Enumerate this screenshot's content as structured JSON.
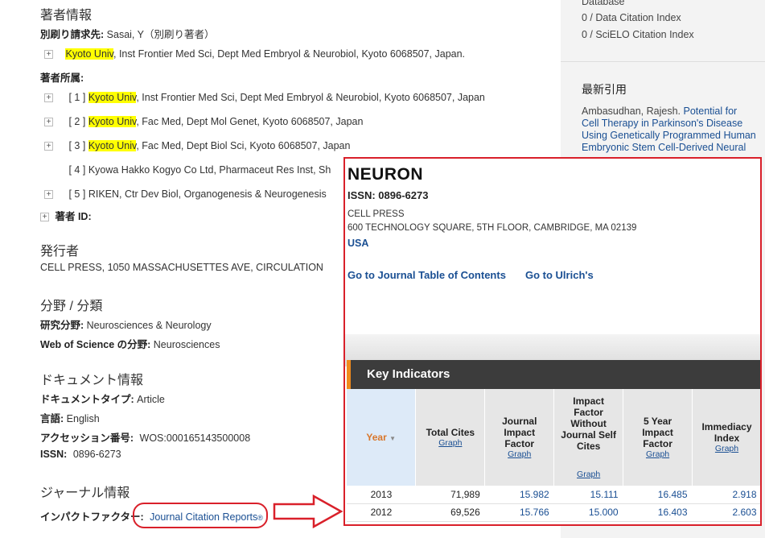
{
  "author": {
    "section_title": "著者情報",
    "reprint_label": "別刷り請求先:",
    "reprint_value": "Sasai, Y（別刷り著者）",
    "reprint_org": "Kyoto Univ",
    "reprint_addr": ", Inst Frontier Med Sci, Dept Med Embryol & Neurobiol, Kyoto 6068507, Japan.",
    "affil_label": "著者所属:",
    "affiliations": [
      {
        "num": "[ 1 ]",
        "org": "Kyoto Univ",
        "rest": ", Inst Frontier Med Sci, Dept Med Embryol & Neurobiol, Kyoto 6068507, Japan"
      },
      {
        "num": "[ 2 ]",
        "org": "Kyoto Univ",
        "rest": ", Fac Med, Dept Mol Genet, Kyoto 6068507, Japan"
      },
      {
        "num": "[ 3 ]",
        "org": "Kyoto Univ",
        "rest": ", Fac Med, Dept Biol Sci, Kyoto 6068507, Japan"
      },
      {
        "num": "[ 4 ]",
        "org": "",
        "rest": "Kyowa Hakko Kogyo Co Ltd, Pharmaceut Res Inst, Sh"
      },
      {
        "num": "[ 5 ]",
        "org": "",
        "rest": "RIKEN, Ctr Dev Biol, Organogenesis & Neurogenesis"
      }
    ],
    "author_id_label": "著者 ID:"
  },
  "publisher": {
    "section_title": "発行者",
    "value": "CELL PRESS, 1050 MASSACHUSETTES AVE, CIRCULATION"
  },
  "category": {
    "section_title": "分野 / 分類",
    "research_label": "研究分野:",
    "research_value": "Neurosciences & Neurology",
    "wos_label": "Web of Science の分野:",
    "wos_value": "Neurosciences"
  },
  "document": {
    "section_title": "ドキュメント情報",
    "type_label": "ドキュメントタイプ:",
    "type_value": "Article",
    "lang_label": "言語:",
    "lang_value": "English",
    "accession_label": "アクセッション番号:",
    "accession_value": "WOS:000165143500008",
    "issn_label": "ISSN:",
    "issn_value": "0896-6273"
  },
  "journal": {
    "section_title": "ジャーナル情報",
    "impact_label": "インパクトファクター:",
    "impact_link": "Journal Citation Reports",
    "impact_link_mark": "®"
  },
  "sidebar": {
    "top_line": "Database",
    "counts": [
      "0 / Data Citation Index",
      "0 / SciELO Citation Index"
    ],
    "latest_title": "最新引用",
    "latest_author": "Ambasudhan, Rajesh.",
    "latest_links": [
      "Potential for",
      "Cell Therapy in Parkinson's Disease",
      "Using Genetically Programmed Human",
      "Embryonic Stem Cell-Derived Neural"
    ]
  },
  "popup": {
    "journal_name": "NEURON",
    "issn": "ISSN: 0896-6273",
    "publisher_name": "CELL PRESS",
    "address": "600 TECHNOLOGY SQUARE, 5TH FLOOR, CAMBRIDGE, MA 02139",
    "country": "USA",
    "link_toc": "Go to Journal Table of Contents",
    "link_ulrich": "Go to Ulrich's",
    "ki_title": "Key Indicators",
    "columns": {
      "year": "Year",
      "total_cites": "Total Cites",
      "jif": "Journal Impact Factor",
      "jif_wo_self": "Impact Factor Without Journal Self Cites",
      "five_year": "5 Year Impact Factor",
      "immediacy": "Immediacy Index",
      "graph": "Graph"
    },
    "rows": [
      {
        "year": "2013",
        "total_cites": "71,989",
        "jif": "15.982",
        "jif_wo_self": "15.111",
        "five_year": "16.485",
        "immediacy": "2.918"
      },
      {
        "year": "2012",
        "total_cites": "69,526",
        "jif": "15.766",
        "jif_wo_self": "15.000",
        "five_year": "16.403",
        "immediacy": "2.603"
      }
    ]
  },
  "colors": {
    "highlight": "#ffff00",
    "annotation": "#d9202a",
    "link": "#1a4f93",
    "accent_orange": "#f08a1c"
  }
}
